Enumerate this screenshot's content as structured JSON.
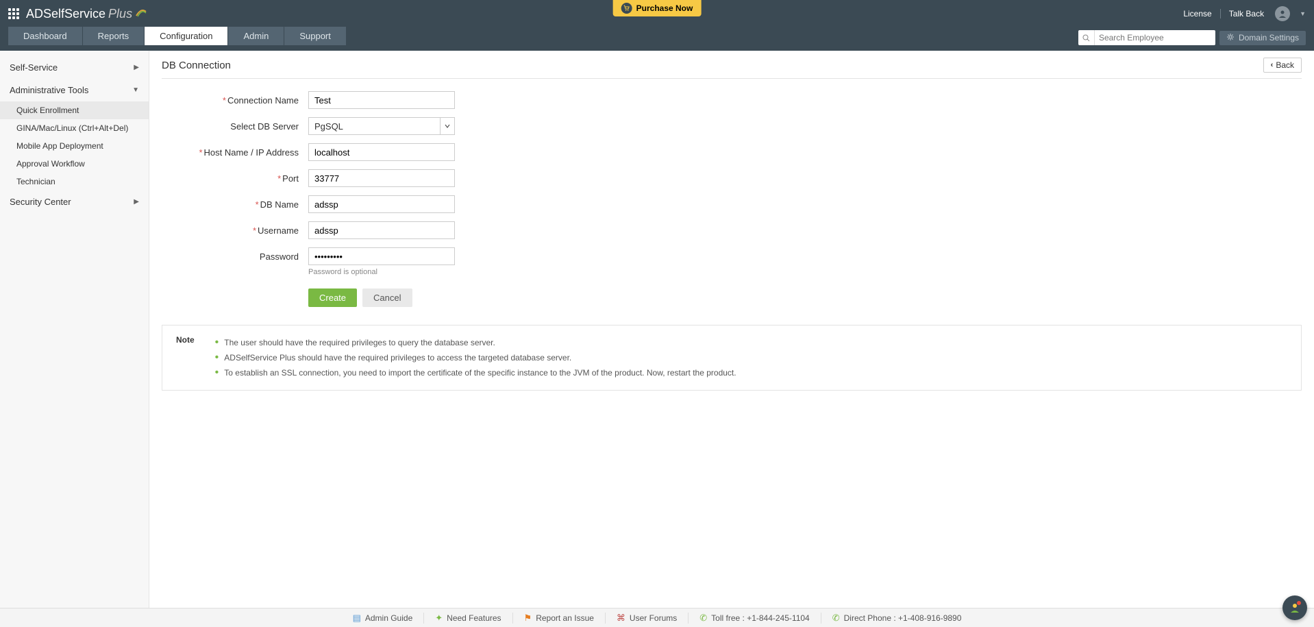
{
  "header": {
    "app_name": "ADSelfService",
    "app_suffix": "Plus",
    "purchase": "Purchase Now",
    "license": "License",
    "talk_back": "Talk Back",
    "search_placeholder": "Search Employee",
    "domain_settings": "Domain Settings"
  },
  "tabs": {
    "dashboard": "Dashboard",
    "reports": "Reports",
    "configuration": "Configuration",
    "admin": "Admin",
    "support": "Support"
  },
  "sidebar": {
    "self_service": "Self-Service",
    "admin_tools": "Administrative Tools",
    "admin_tools_items": {
      "quick_enrollment": "Quick Enrollment",
      "gina": "GINA/Mac/Linux (Ctrl+Alt+Del)",
      "mobile": "Mobile App Deployment",
      "approval": "Approval Workflow",
      "technician": "Technician"
    },
    "security_center": "Security Center"
  },
  "page": {
    "title": "DB Connection",
    "back": "Back"
  },
  "form": {
    "labels": {
      "connection_name": "Connection Name",
      "select_db": "Select DB Server",
      "host": "Host Name / IP Address",
      "port": "Port",
      "db_name": "DB Name",
      "username": "Username",
      "password": "Password"
    },
    "values": {
      "connection_name": "Test",
      "select_db": "PgSQL",
      "host": "localhost",
      "port": "33777",
      "db_name": "adssp",
      "username": "adssp",
      "password": "•••••••••"
    },
    "hint": "Password is optional",
    "create": "Create",
    "cancel": "Cancel"
  },
  "note": {
    "label": "Note",
    "items": [
      "The user should have the required privileges to query the database server.",
      "ADSelfService Plus should have the required privileges to access the targeted database server.",
      "To establish an SSL connection, you need to import the certificate of the specific instance to the JVM of the product. Now, restart the product."
    ]
  },
  "footer": {
    "admin_guide": "Admin Guide",
    "need_features": "Need Features",
    "report_issue": "Report an Issue",
    "user_forums": "User Forums",
    "toll_free": "Toll free : +1-844-245-1104",
    "direct_phone": "Direct Phone : +1-408-916-9890"
  },
  "colors": {
    "header_bg": "#3b4a54",
    "tab_inactive": "#546572",
    "accent_green": "#7ab943",
    "purchase_yellow": "#f7c945"
  }
}
